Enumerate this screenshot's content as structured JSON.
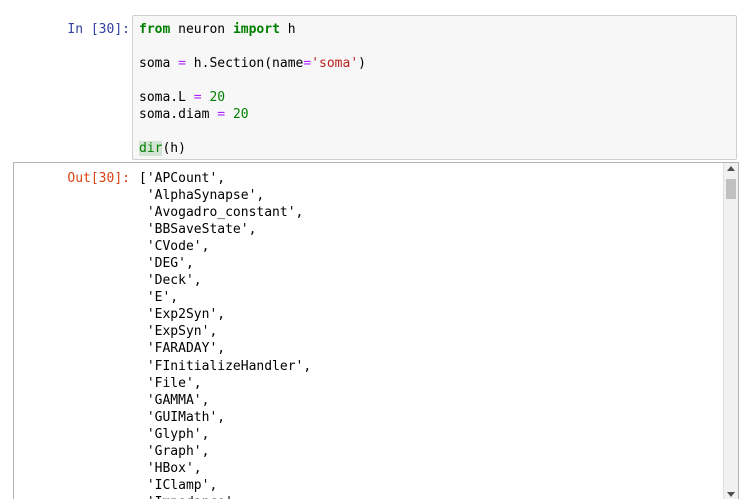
{
  "input_cell": {
    "prompt": "In [30]:",
    "lines": {
      "l1": {
        "kw1": "from",
        "t1": " neuron ",
        "kw2": "import",
        "t2": " h"
      },
      "l3": {
        "t1": "soma ",
        "op": "=",
        "t2": " h.Section(name",
        "op2": "=",
        "str": "'soma'",
        "t3": ")"
      },
      "l5": {
        "t1": "soma.L ",
        "op": "=",
        "t2": " ",
        "num": "20"
      },
      "l6": {
        "t1": "soma.diam ",
        "op": "=",
        "t2": " ",
        "num": "20"
      },
      "l8": {
        "fn": "dir",
        "t1": "(h)"
      }
    }
  },
  "output_cell": {
    "prompt": "Out[30]:",
    "text": "['APCount',\n 'AlphaSynapse',\n 'Avogadro_constant',\n 'BBSaveState',\n 'CVode',\n 'DEG',\n 'Deck',\n 'E',\n 'Exp2Syn',\n 'ExpSyn',\n 'FARADAY',\n 'FInitializeHandler',\n 'File',\n 'GAMMA',\n 'GUIMath',\n 'Glyph',\n 'Graph',\n 'HBox',\n 'IClamp',\n 'Impedance',"
  },
  "colors": {
    "prompt_in": "#303f9f",
    "prompt_out": "#d84315",
    "keyword": "#008000",
    "string": "#ba2121",
    "operator": "#aa22ff"
  }
}
